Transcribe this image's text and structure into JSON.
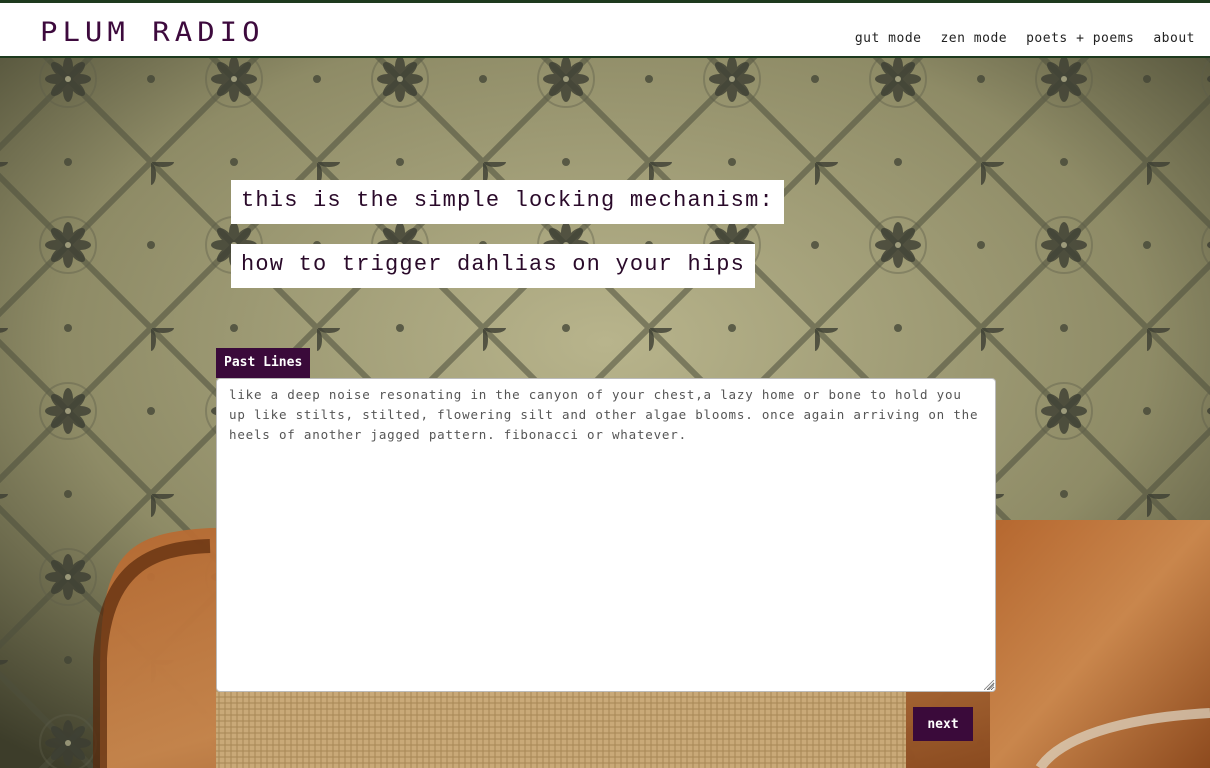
{
  "header": {
    "logo": "PLUM RADIO",
    "nav": [
      "gut mode",
      "zen mode",
      "poets + poems",
      "about"
    ]
  },
  "prompt": {
    "line1": "this is the simple locking mechanism:",
    "line2": "how to trigger dahlias on your hips"
  },
  "past_lines": {
    "label": "Past Lines",
    "text": "like a deep noise resonating in the canyon of your chest,a lazy home or bone to hold you up like stilts, stilted, flowering silt and other algae blooms. once again arriving on the heels of another jagged pattern. fibonacci or whatever."
  },
  "actions": {
    "next_label": "next"
  },
  "colors": {
    "plum": "#3a0a3a",
    "header_border": "#1e3a1e"
  }
}
